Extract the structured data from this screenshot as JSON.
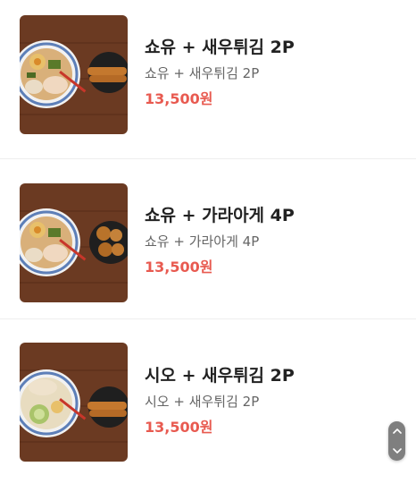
{
  "menu": {
    "items": [
      {
        "name": "쇼유 + 새우튀김 2P",
        "description": "쇼유 + 새우튀김 2P",
        "price": "13,500원",
        "image_icon": "ramen-with-fried-shrimp-photo"
      },
      {
        "name": "쇼유 + 가라아게 4P",
        "description": "쇼유 + 가라아게 4P",
        "price": "13,500원",
        "image_icon": "ramen-with-karaage-photo"
      },
      {
        "name": "시오 + 새우튀김 2P",
        "description": "시오 + 새우튀김 2P",
        "price": "13,500원",
        "image_icon": "shio-ramen-with-fried-shrimp-photo"
      }
    ]
  },
  "scroll_control": {
    "up_icon": "chevron-up-icon",
    "down_icon": "chevron-down-icon"
  },
  "colors": {
    "price": "#e85a50",
    "title": "#222222",
    "description": "#666666"
  }
}
